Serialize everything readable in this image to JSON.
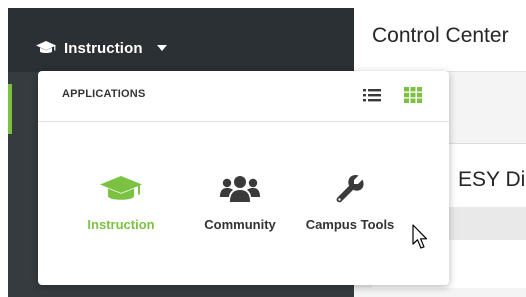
{
  "header": {
    "app_switcher_label": "Instruction",
    "app_switcher_icon": "graduation-cap-icon",
    "caret_icon": "caret-down-icon"
  },
  "main": {
    "page_title": "Control Center",
    "card_title": "ESY Di"
  },
  "dropdown": {
    "title": "APPLICATIONS",
    "view_icons": [
      "list-view-icon",
      "grid-view-icon"
    ],
    "active_view": "grid",
    "apps": [
      {
        "label": "Instruction",
        "icon": "graduation-cap-icon",
        "active": true
      },
      {
        "label": "Community",
        "icon": "users-icon",
        "active": false
      },
      {
        "label": "Campus Tools",
        "icon": "wrench-icon",
        "active": false
      }
    ]
  },
  "colors": {
    "accent": "#7cc242",
    "sidebar": "#2b3034",
    "text": "#333333"
  }
}
